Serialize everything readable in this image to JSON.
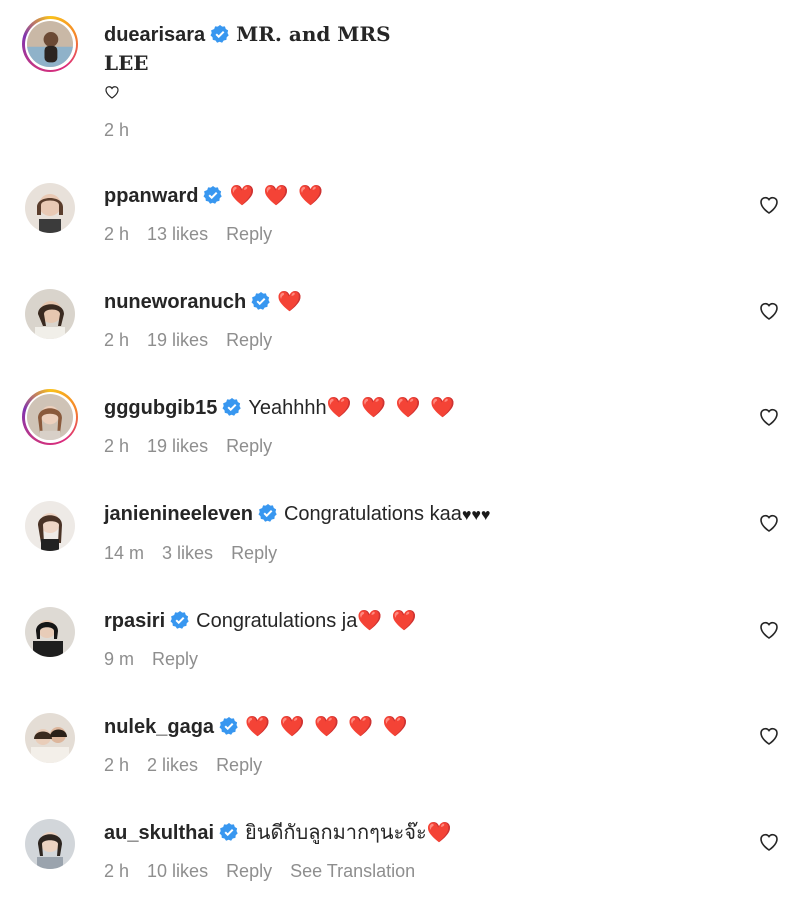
{
  "caption": {
    "username": "duearisara",
    "text_line1": "MR. and MRS",
    "text_line2": "LEE",
    "heart": "♡",
    "time": "2 h"
  },
  "comments": [
    {
      "username": "ppanward",
      "text": "",
      "hearts": "❤️ ❤️ ❤️",
      "time": "2 h",
      "likes": "13 likes",
      "reply": "Reply"
    },
    {
      "username": "nuneworanuch",
      "text": "",
      "hearts": "❤️",
      "time": "2 h",
      "likes": "19 likes",
      "reply": "Reply"
    },
    {
      "username": "gggubgib15",
      "text": "Yeahhhh",
      "hearts": "❤️ ❤️ ❤️ ❤️",
      "time": "2 h",
      "likes": "19 likes",
      "reply": "Reply"
    },
    {
      "username": "janienineeleven",
      "text": "Congratulations kaa",
      "hearts": "♥♥♥",
      "time": "14 m",
      "likes": "3 likes",
      "reply": "Reply"
    },
    {
      "username": "rpasiri",
      "text": "Congratulations ja",
      "hearts": "❤️ ❤️",
      "time": "9 m",
      "likes": "",
      "reply": "Reply"
    },
    {
      "username": "nulek_gaga",
      "text": "",
      "hearts": "❤️ ❤️ ❤️ ❤️ ❤️",
      "time": "2 h",
      "likes": "2 likes",
      "reply": "Reply"
    },
    {
      "username": "au_skulthai",
      "text": "ยินดีกับลูกมากๆนะจ๊ะ",
      "hearts": "❤️",
      "time": "2 h",
      "likes": "10 likes",
      "reply": "Reply",
      "translation": "See Translation"
    }
  ],
  "colors": {
    "verified": "#3897f0",
    "meta_text": "#8e8e8e",
    "heart_red": "#ed1c24"
  }
}
